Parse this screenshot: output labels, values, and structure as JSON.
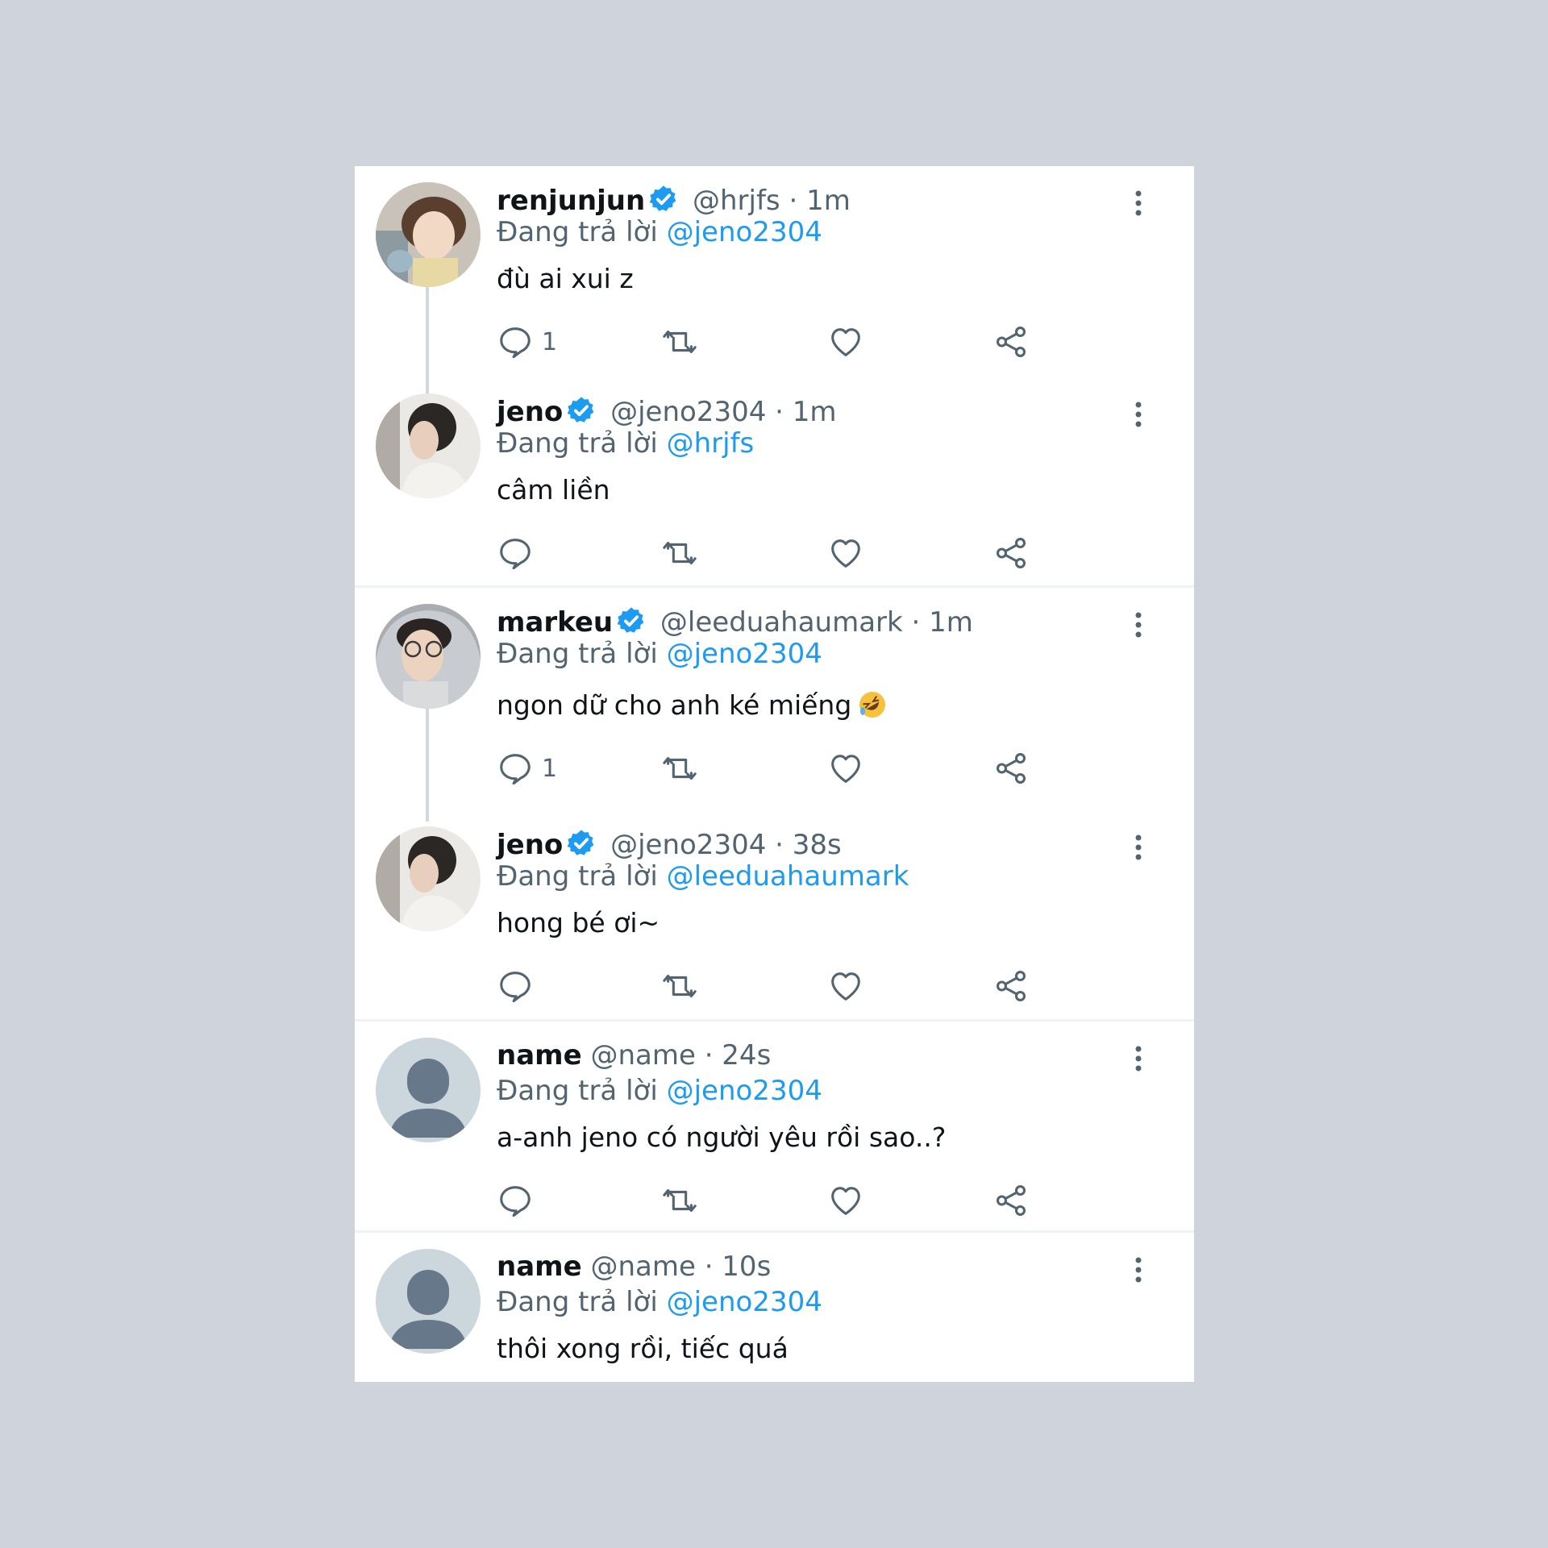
{
  "reply_prefix": "Đang trả lời",
  "tweets": [
    {
      "name": "renjunjun",
      "handle": "@hrjfs",
      "time": "· 1m",
      "verified": true,
      "reply_to": "@jeno2304",
      "text": "đù ai xui z",
      "reply_count": "1",
      "avatar": "photo-renjun"
    },
    {
      "name": "jeno",
      "handle": "@jeno2304",
      "time": "· 1m",
      "verified": true,
      "reply_to": "@hrjfs",
      "text": "câm liền",
      "reply_count": "",
      "avatar": "photo-jeno"
    },
    {
      "name": "markeu",
      "handle": "@leeduahaumark",
      "time": "· 1m",
      "verified": true,
      "reply_to": "@jeno2304",
      "text": "ngon dữ cho anh ké miếng",
      "emoji": "rolling-on-floor-laughing",
      "reply_count": "1",
      "avatar": "photo-mark"
    },
    {
      "name": "jeno",
      "handle": "@jeno2304",
      "time": "· 38s",
      "verified": true,
      "reply_to": "@leeduahaumark",
      "text": "hong bé ơi~",
      "reply_count": "",
      "avatar": "photo-jeno"
    },
    {
      "name": "name",
      "handle": "@name",
      "time": "· 24s",
      "verified": false,
      "reply_to": "@jeno2304",
      "text": "a-anh jeno có người yêu rồi sao..?",
      "reply_count": "",
      "avatar": "default-avatar"
    },
    {
      "name": "name",
      "handle": "@name",
      "time": "· 10s",
      "verified": false,
      "reply_to": "@jeno2304",
      "text": "thôi xong rồi, tiếc quá",
      "reply_count": "",
      "avatar": "default-avatar"
    }
  ],
  "icons": {
    "reply": "reply-icon",
    "retweet": "retweet-icon",
    "like": "heart-icon",
    "share": "share-icon",
    "more": "more-vertical-icon",
    "verified": "verified-badge-icon"
  },
  "colors": {
    "page_background": "#cfd3db",
    "card_background": "#ffffff",
    "mention": "#1d9bf0",
    "verified": "#1d9bf0",
    "secondary_text": "#536471",
    "primary_text": "#0f1419"
  }
}
